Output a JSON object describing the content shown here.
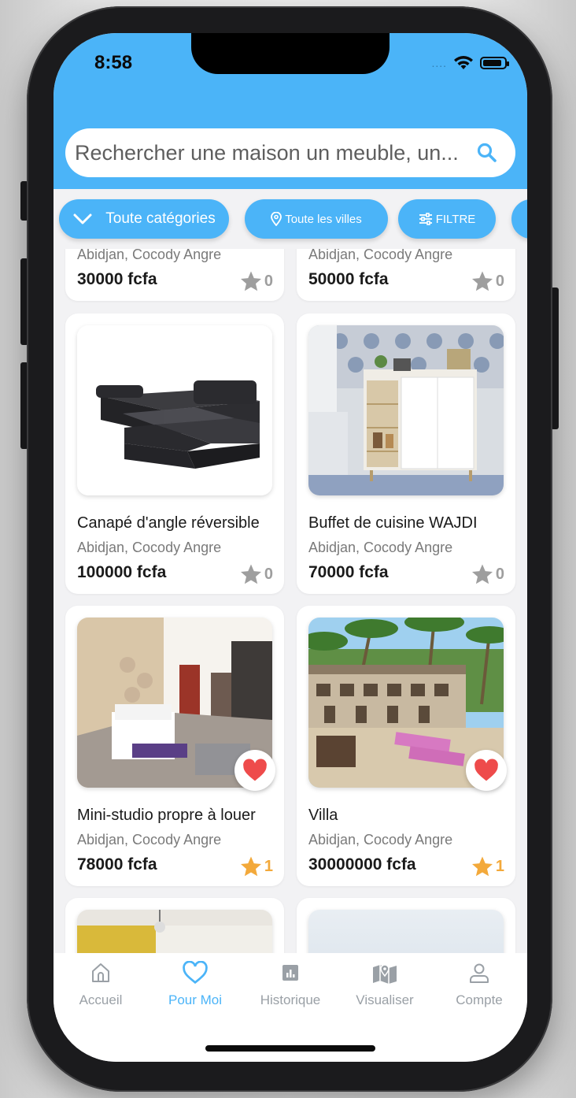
{
  "status_bar": {
    "time": "8:58",
    "signal": "....",
    "battery_level": 0.9
  },
  "search": {
    "placeholder": "Rechercher une maison un meuble, un..."
  },
  "filters": {
    "category_label": "Toute catégories",
    "city_label": "Toute les villes",
    "filter_label": "FILTRE"
  },
  "listings": [
    {
      "title": "",
      "location": "Abidjan, Cocody Angre",
      "price": "30000 fcfa",
      "rating": "0",
      "favorite": false
    },
    {
      "title": "",
      "location": "Abidjan, Cocody Angre",
      "price": "50000 fcfa",
      "rating": "0",
      "favorite": false
    },
    {
      "title": "Canapé d'angle réversible",
      "location": "Abidjan, Cocody Angre",
      "price": "100000 fcfa",
      "rating": "0",
      "favorite": false
    },
    {
      "title": "Buffet de cuisine WAJDI",
      "location": "Abidjan, Cocody Angre",
      "price": "70000 fcfa",
      "rating": "0",
      "favorite": false
    },
    {
      "title": "Mini-studio propre à louer",
      "location": "Abidjan, Cocody Angre",
      "price": "78000 fcfa",
      "rating": "1",
      "favorite": true
    },
    {
      "title": "Villa",
      "location": "Abidjan, Cocody Angre",
      "price": "30000000 fcfa",
      "rating": "1",
      "favorite": true
    }
  ],
  "tabs": [
    {
      "label": "Accueil",
      "icon": "home-icon",
      "active": false
    },
    {
      "label": "Pour Moi",
      "icon": "heart-icon",
      "active": true
    },
    {
      "label": "Historique",
      "icon": "chart-icon",
      "active": false
    },
    {
      "label": "Visualiser",
      "icon": "map-icon",
      "active": false
    },
    {
      "label": "Compte",
      "icon": "user-icon",
      "active": false
    }
  ],
  "colors": {
    "primary": "#4bb4f8",
    "star_inactive": "#9e9e9e",
    "star_active": "#f3a93b",
    "heart": "#ee4b4b",
    "tab_inactive": "#9aa0a6"
  }
}
